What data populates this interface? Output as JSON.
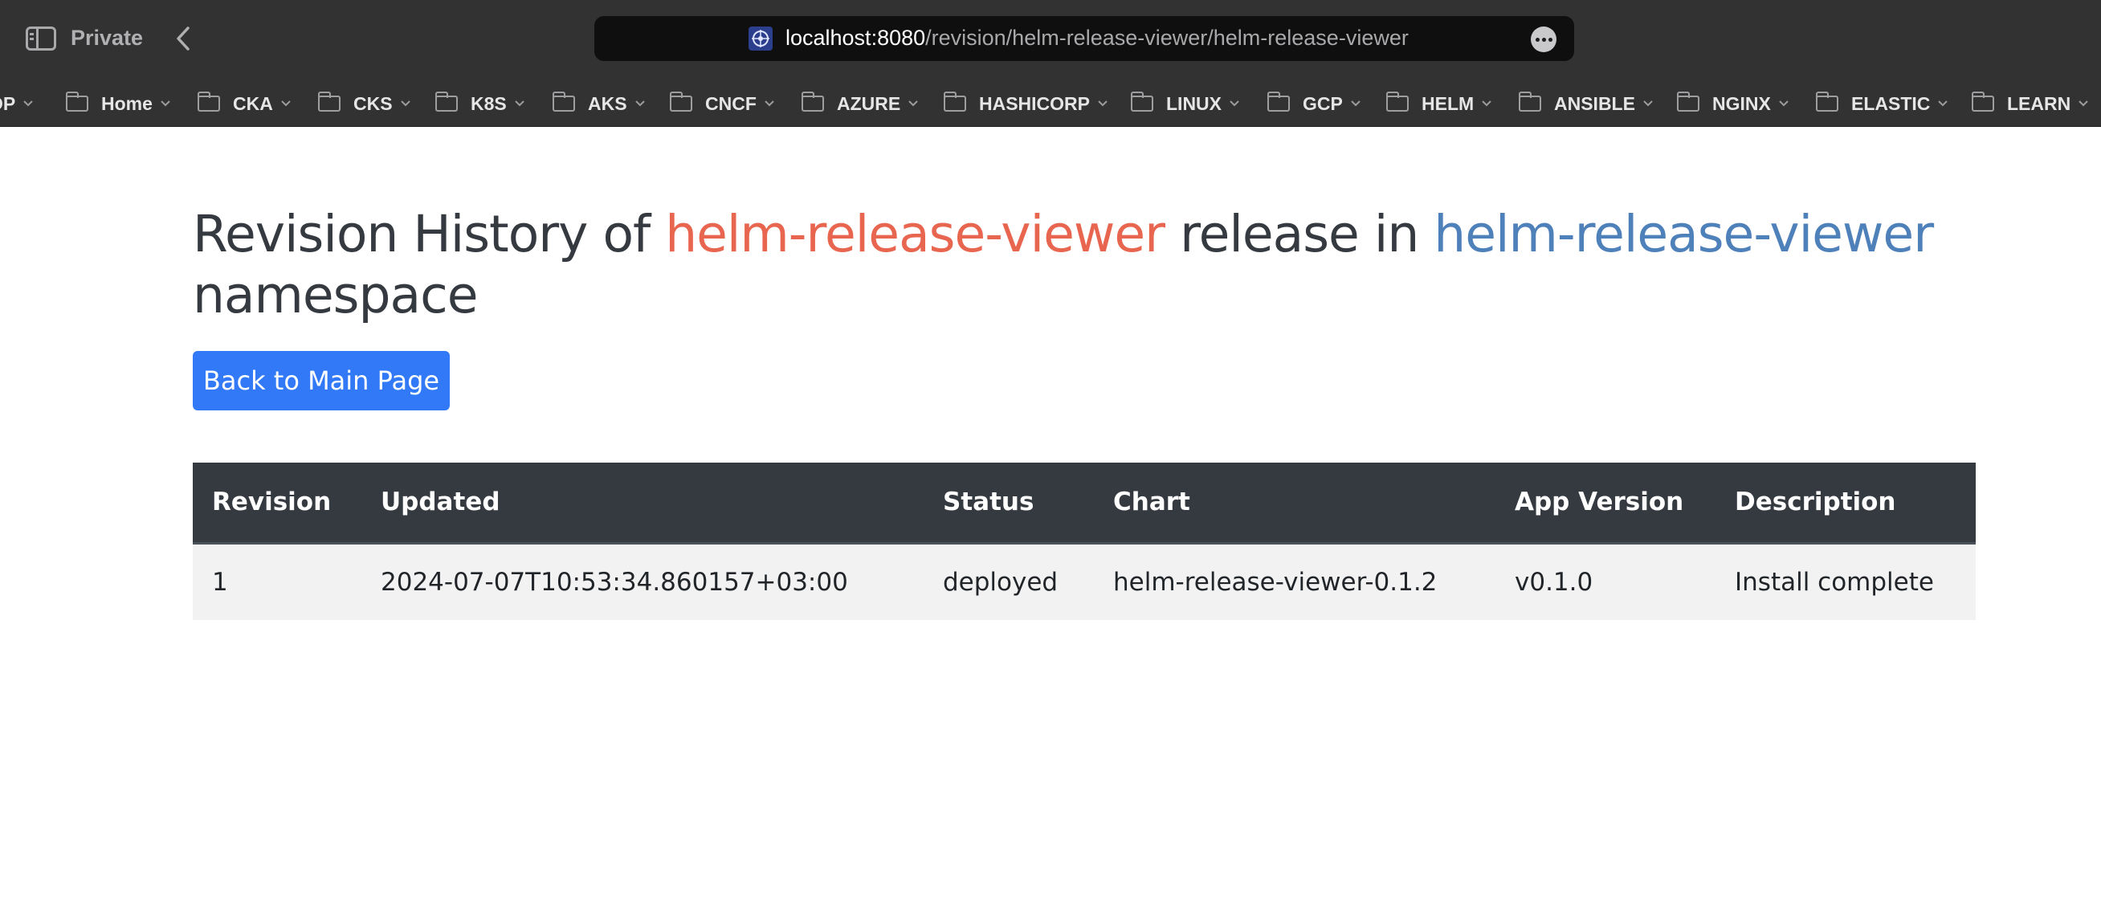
{
  "browser": {
    "private_label": "Private",
    "url_host": "localhost:8080",
    "url_path": "/revision/helm-release-viewer/helm-release-viewer",
    "bookmarks": [
      {
        "label": "OP"
      },
      {
        "label": "Home"
      },
      {
        "label": "CKA"
      },
      {
        "label": "CKS"
      },
      {
        "label": "K8S"
      },
      {
        "label": "AKS"
      },
      {
        "label": "CNCF"
      },
      {
        "label": "AZURE"
      },
      {
        "label": "HASHICORP"
      },
      {
        "label": "LINUX"
      },
      {
        "label": "GCP"
      },
      {
        "label": "HELM"
      },
      {
        "label": "ANSIBLE"
      },
      {
        "label": "NGINX"
      },
      {
        "label": "ELASTIC"
      },
      {
        "label": "LEARN"
      }
    ]
  },
  "page": {
    "heading_prefix": "Revision History of ",
    "release_name": "helm-release-viewer",
    "heading_middle": " release in ",
    "namespace_name": "helm-release-viewer",
    "heading_suffix": " namespace",
    "back_button_label": "Back to Main Page"
  },
  "table": {
    "headers": [
      "Revision",
      "Updated",
      "Status",
      "Chart",
      "App Version",
      "Description"
    ],
    "rows": [
      [
        "1",
        "2024-07-07T10:53:34.860157+03:00",
        "deployed",
        "helm-release-viewer-0.1.2",
        "v0.1.0",
        "Install complete"
      ]
    ]
  },
  "colors": {
    "release_accent": "#e8664f",
    "namespace_accent": "#4e80b9",
    "button_primary": "#3179f6",
    "table_header_bg": "#343a40"
  }
}
